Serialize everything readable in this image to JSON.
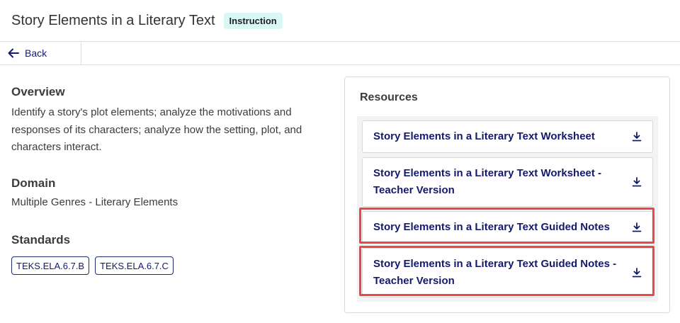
{
  "header": {
    "title": "Story Elements in a Literary Text",
    "badge": "Instruction"
  },
  "nav": {
    "back_label": "Back"
  },
  "overview": {
    "heading": "Overview",
    "text": "Identify a story's plot elements; analyze the motivations and responses of its characters; analyze how the setting, plot, and characters interact."
  },
  "domain": {
    "heading": "Domain",
    "value": "Multiple Genres - Literary Elements"
  },
  "standards": {
    "heading": "Standards",
    "items": [
      "TEKS.ELA.6.7.B",
      "TEKS.ELA.6.7.C"
    ]
  },
  "resources": {
    "heading": "Resources",
    "items": [
      {
        "label": "Story Elements in a Literary Text Worksheet",
        "icon": "download-icon"
      },
      {
        "label": "Story Elements in a Literary Text Worksheet - Teacher Version",
        "icon": "download-icon"
      },
      {
        "label": "Story Elements in a Literary Text Guided Notes",
        "icon": "download-icon"
      },
      {
        "label": "Story Elements in a Literary Text Guided Notes - Teacher Version",
        "icon": "download-icon"
      }
    ]
  },
  "colors": {
    "link": "#141a6b",
    "badge_bg": "#d9f7f4",
    "highlight": "#e8484a"
  }
}
